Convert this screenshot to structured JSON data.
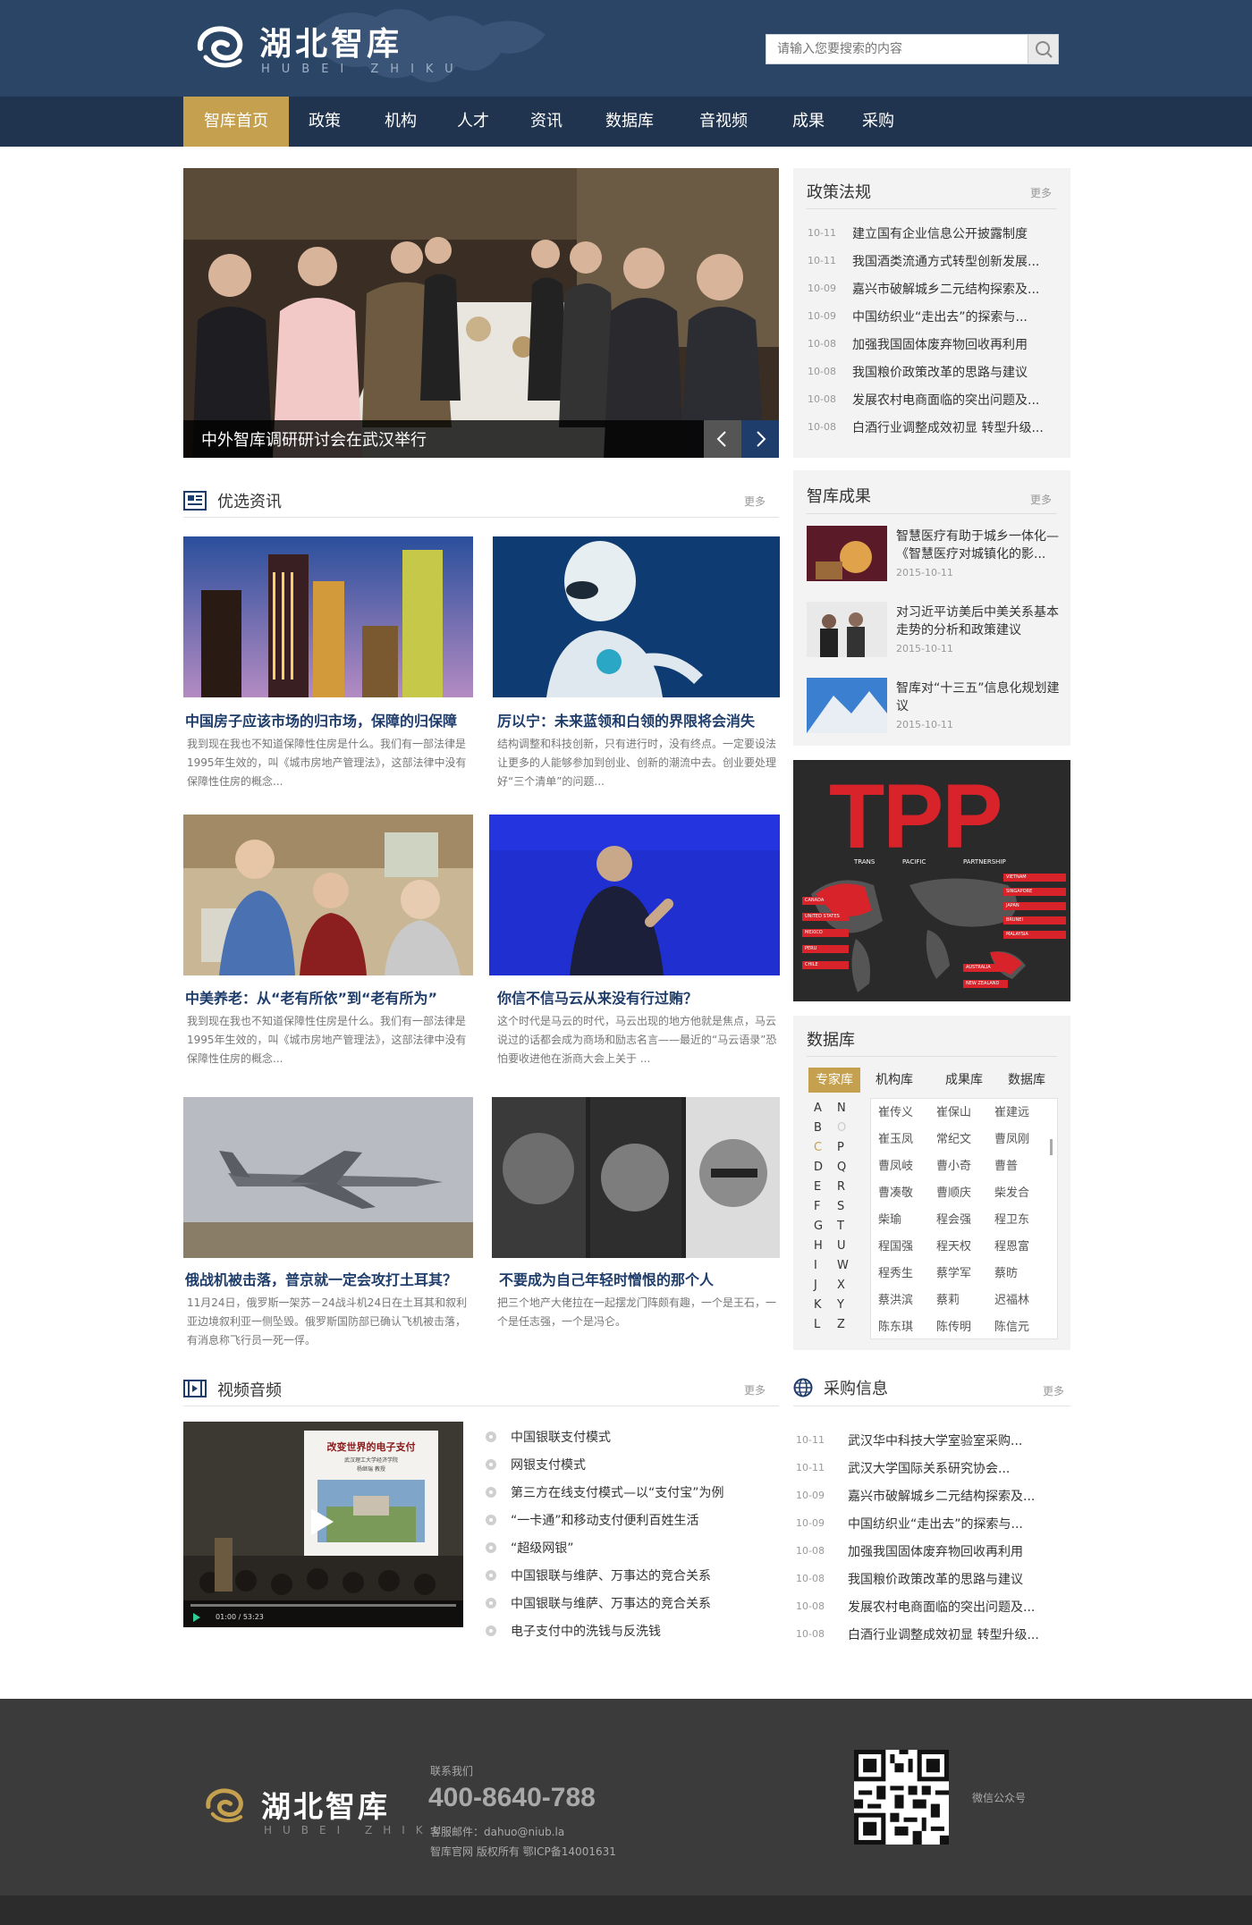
{
  "header": {
    "logo_cn": "湖北智库",
    "logo_en": "HUBEI ZHIKU",
    "search_placeholder": "请输入您要搜索的内容"
  },
  "nav": [
    "智库首页",
    "政策",
    "机构",
    "人才",
    "资讯",
    "数据库",
    "音视频",
    "成果",
    "采购"
  ],
  "slider": {
    "caption": "中外智库调研研讨会在武汉举行"
  },
  "policy": {
    "title": "政策法规",
    "more": "更多",
    "items": [
      {
        "date": "10-11",
        "text": "建立国有企业信息公开披露制度"
      },
      {
        "date": "10-11",
        "text": "我国酒类流通方式转型创新发展..."
      },
      {
        "date": "10-09",
        "text": "嘉兴市破解城乡二元结构探索及..."
      },
      {
        "date": "10-09",
        "text": "中国纺织业“走出去”的探索与..."
      },
      {
        "date": "10-08",
        "text": "加强我国固体废弃物回收再利用"
      },
      {
        "date": "10-08",
        "text": "我国粮价政策改革的思路与建议"
      },
      {
        "date": "10-08",
        "text": "发展农村电商面临的突出问题及..."
      },
      {
        "date": "10-08",
        "text": "白酒行业调整成效初显 转型升级..."
      }
    ]
  },
  "news": {
    "title": "优选资讯",
    "more": "更多",
    "cards": [
      {
        "title": "中国房子应该市场的归市场，保障的归保障",
        "desc": "我到现在我也不知道保障性住房是什么。我们有一部法律是1995年生效的，叫《城市房地产管理法》，这部法律中没有保障性住房的概念..."
      },
      {
        "title": "厉以宁：未来蓝领和白领的界限将会消失",
        "desc": "结构调整和科技创新，只有进行时，没有终点。一定要设法让更多的人能够参加到创业、创新的潮流中去。创业要处理好“三个清单”的问题..."
      },
      {
        "title": "中美养老：从“老有所依”到“老有所为”",
        "desc": "我到现在我也不知道保障性住房是什么。我们有一部法律是1995年生效的，叫《城市房地产管理法》，这部法律中没有保障性住房的概念..."
      },
      {
        "title": "你信不信马云从来没有行过贿？",
        "desc": "这个时代是马云的时代，马云出现的地方他就是焦点，马云说过的话都会成为商场和励志名言——最近的“马云语录”恐怕要收进他在浙商大会上关于 ..."
      },
      {
        "title": "俄战机被击落，普京就一定会攻打土耳其？",
        "desc": "11月24日，俄罗斯一架苏－24战斗机24日在土耳其和叙利亚边境叙利亚一侧坠毁。俄罗斯国防部已确认飞机被击落，有消息称飞行员一死一俘。"
      },
      {
        "title": "不要成为自己年轻时憎恨的那个人",
        "desc": "把三个地产大佬拉在一起摆龙门阵颇有趣，一个是王石，一个是任志强，一个是冯仑。"
      }
    ]
  },
  "achievements": {
    "title": "智库成果",
    "more": "更多",
    "items": [
      {
        "title": "智慧医疗有助于城乡一体化—《智慧医疗对城镇化的影...",
        "date": "2015-10-11"
      },
      {
        "title": "对习近平访美后中美关系基本走势的分析和政策建议",
        "date": "2015-10-11"
      },
      {
        "title": "智库对“十三五”信息化规划建议",
        "date": "2015-10-11"
      }
    ]
  },
  "tpp": {
    "word": "TPP",
    "sub1": "TRANS",
    "sub2": "PACIFIC",
    "sub3": "PARTNERSHIP",
    "countries": [
      "VIETNAM",
      "SINGAPORE",
      "JAPAN",
      "BRUNEI",
      "MALAYSIA",
      "CANADA",
      "UNITED STATES",
      "MEXICO",
      "PERU",
      "CHILE",
      "AUSTRALIA",
      "NEW ZEALAND"
    ]
  },
  "database": {
    "title": "数据库",
    "tabs": [
      "专家库",
      "机构库",
      "成果库",
      "数据库"
    ],
    "letters_left": [
      "A",
      "B",
      "C",
      "D",
      "E",
      "F",
      "G",
      "H",
      "I",
      "J",
      "K",
      "L"
    ],
    "letters_right": [
      "N",
      "O",
      "P",
      "Q",
      "R",
      "S",
      "T",
      "U",
      "W",
      "X",
      "Y",
      "Z"
    ],
    "names": [
      [
        "崔传义",
        "崔保山",
        "崔建远"
      ],
      [
        "崔玉凤",
        "常纪文",
        "曹凤刚"
      ],
      [
        "曹凤岐",
        "曹小奇",
        "曹普"
      ],
      [
        "曹凑敬",
        "曹顺庆",
        "柴发合"
      ],
      [
        "柴瑜",
        "程会强",
        "程卫东"
      ],
      [
        "程国强",
        "程天权",
        "程恩富"
      ],
      [
        "程秀生",
        "蔡学军",
        "蔡昉"
      ],
      [
        "蔡洪滨",
        "蔡莉",
        "迟福林"
      ],
      [
        "陈东琪",
        "陈传明",
        "陈信元"
      ]
    ]
  },
  "video": {
    "title": "视频音频",
    "more": "更多",
    "screen_title": "改变世界的电子支付",
    "screen_sub1": "武汉理工大学经济学院",
    "screen_sub2": "杨继瑞 教授",
    "time": "01:00 / 53:23",
    "items": [
      "中国银联支付模式",
      "网银支付模式",
      "第三方在线支付模式—以“支付宝”为例",
      "“一卡通”和移动支付便利百姓生活",
      "“超级网银”",
      "中国银联与维萨、万事达的竞合关系",
      "中国银联与维萨、万事达的竞合关系",
      "电子支付中的洗钱与反洗钱"
    ]
  },
  "purchase": {
    "title": "采购信息",
    "more": "更多",
    "items": [
      {
        "date": "10-11",
        "text": "武汉华中科技大学室验室采购..."
      },
      {
        "date": "10-11",
        "text": "武汉大学国际关系研究协会..."
      },
      {
        "date": "10-09",
        "text": "嘉兴市破解城乡二元结构探索及..."
      },
      {
        "date": "10-09",
        "text": "中国纺织业“走出去”的探索与..."
      },
      {
        "date": "10-08",
        "text": "加强我国固体废弃物回收再利用"
      },
      {
        "date": "10-08",
        "text": "我国粮价政策改革的思路与建议"
      },
      {
        "date": "10-08",
        "text": "发展农村电商面临的突出问题及..."
      },
      {
        "date": "10-08",
        "text": "白酒行业调整成效初显 转型升级..."
      }
    ]
  },
  "footer": {
    "logo_cn": "湖北智库",
    "logo_en": "HUBEI ZHIKU",
    "contact_label": "联系我们",
    "phone": "400-8640-788",
    "email": "客服邮件：dahuo@niub.la",
    "copyright": "智库官网  版权所有  鄂ICP备14001631",
    "wechat": "微信公众号"
  },
  "colors": {
    "header": "#2b4567",
    "nav": "#21344f",
    "accent": "#c5a14f",
    "title": "#1f3d6b",
    "tpp_red": "#d8232a",
    "footer": "#3b3b3b"
  }
}
